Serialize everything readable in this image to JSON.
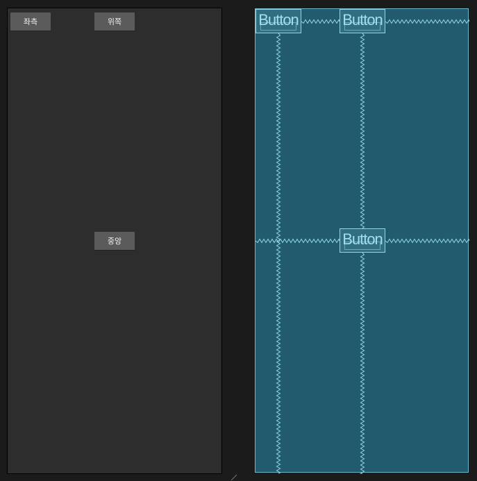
{
  "design_view": {
    "buttons": {
      "left": "좌측",
      "top": "위쪽",
      "center": "중앙"
    }
  },
  "blueprint_view": {
    "buttons": [
      "Button",
      "Button",
      "Button"
    ]
  },
  "colors": {
    "background": "#1b1b1b",
    "design_surface": "#2d2d2d",
    "blueprint_surface": "#225b6d",
    "blueprint_line": "#8fd6e6"
  }
}
